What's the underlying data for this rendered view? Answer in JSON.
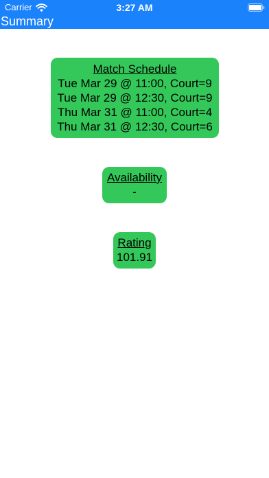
{
  "status_bar": {
    "carrier": "Carrier",
    "time": "3:27 AM"
  },
  "nav": {
    "title": "Summary"
  },
  "schedule_card": {
    "heading": "Match Schedule",
    "matches": [
      "Tue Mar 29 @ 11:00, Court=9",
      "Tue Mar 29 @ 12:30, Court=9",
      "Thu Mar 31 @ 11:00, Court=4",
      "Thu Mar 31 @ 12:30, Court=6"
    ]
  },
  "availability_card": {
    "heading": "Availability",
    "value": "-"
  },
  "rating_card": {
    "heading": "Rating",
    "value": "101.91"
  },
  "colors": {
    "nav_bar": "#1a82fb",
    "card": "#34c759",
    "background": "#ffffff"
  },
  "icons": [
    "wifi-icon",
    "battery-icon"
  ]
}
